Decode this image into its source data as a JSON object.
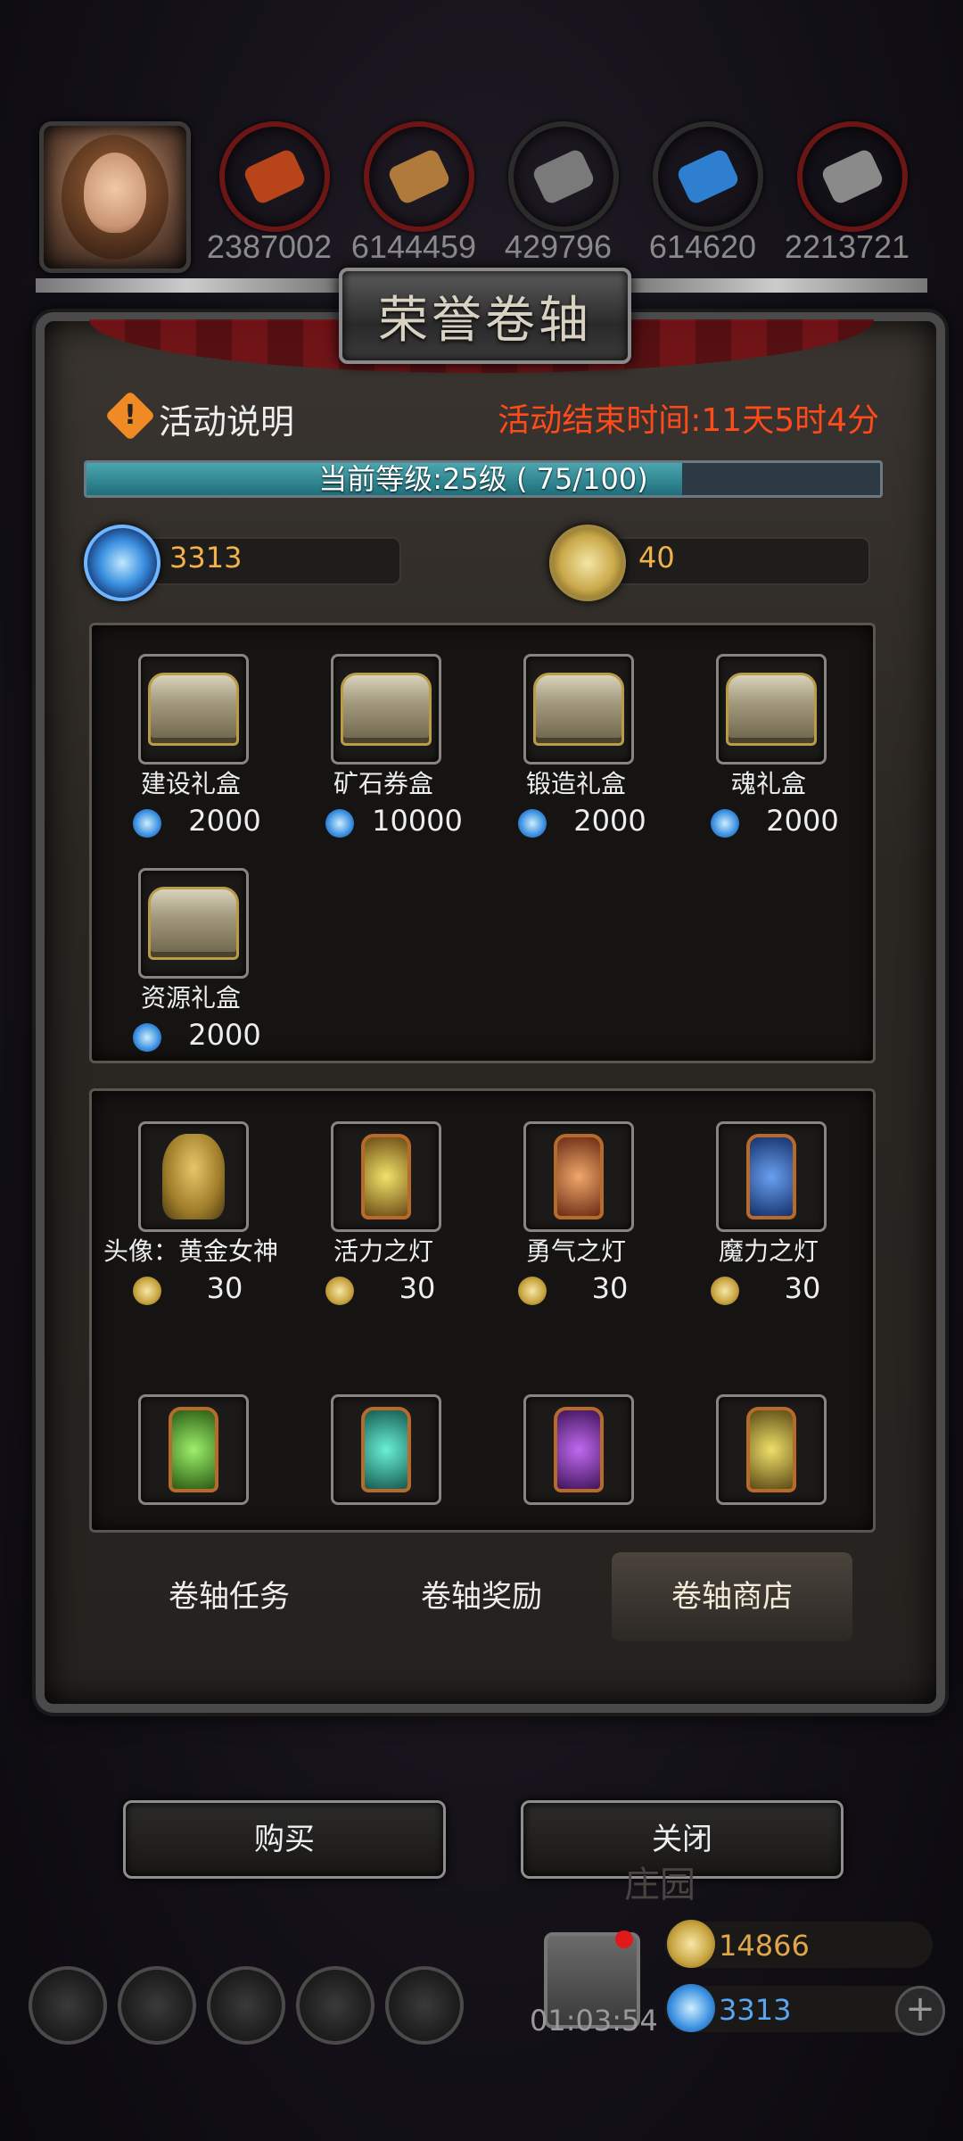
{
  "top_bar": {
    "resources": [
      {
        "icon": "meat-icon",
        "value": "2387002",
        "color": "#b8451a"
      },
      {
        "icon": "wood-icon",
        "value": "6144459",
        "color": "#b07a3a"
      },
      {
        "icon": "iron-icon",
        "value": "429796",
        "color": "#7a7a7a"
      },
      {
        "icon": "crystal-icon",
        "value": "614620",
        "color": "#2f7fd0"
      },
      {
        "icon": "steel-icon",
        "value": "2213721",
        "color": "#8a8a8a"
      }
    ]
  },
  "panel": {
    "title": "荣誉卷轴",
    "info_label": "活动说明",
    "end_time": "活动结束时间:11天5时4分",
    "level": {
      "text": "当前等级:25级 ( 75/100)",
      "current": 75,
      "max": 100
    },
    "diamonds": "3313",
    "coins": "40"
  },
  "shop1": [
    {
      "name": "建设礼盒",
      "cost": "2000",
      "currency": "diamond"
    },
    {
      "name": "矿石券盒",
      "cost": "10000",
      "currency": "diamond"
    },
    {
      "name": "锻造礼盒",
      "cost": "2000",
      "currency": "diamond"
    },
    {
      "name": "魂礼盒",
      "cost": "2000",
      "currency": "diamond"
    },
    {
      "name": "资源礼盒",
      "cost": "2000",
      "currency": "diamond"
    }
  ],
  "shop2": [
    {
      "name": "头像：黄金女神",
      "cost": "30",
      "currency": "coin",
      "icon": "angel-icon"
    },
    {
      "name": "活力之灯",
      "cost": "30",
      "currency": "coin",
      "icon": "lantern-icon",
      "glow": "#f2e36a"
    },
    {
      "name": "勇气之灯",
      "cost": "30",
      "currency": "coin",
      "icon": "lantern-icon",
      "glow": "#f0a86a"
    },
    {
      "name": "魔力之灯",
      "cost": "30",
      "currency": "coin",
      "icon": "lantern-icon",
      "glow": "#6aa0f0"
    },
    {
      "name": "",
      "cost": "",
      "currency": "coin",
      "icon": "lantern-icon",
      "glow": "#9ef06a"
    },
    {
      "name": "",
      "cost": "",
      "currency": "coin",
      "icon": "lantern-icon",
      "glow": "#6af0d8"
    },
    {
      "name": "",
      "cost": "",
      "currency": "coin",
      "icon": "lantern-icon",
      "glow": "#c06af0"
    },
    {
      "name": "",
      "cost": "",
      "currency": "coin",
      "icon": "lantern-icon",
      "glow": "#f0e06a"
    }
  ],
  "tabs": [
    {
      "label": "卷轴任务",
      "active": false
    },
    {
      "label": "卷轴奖励",
      "active": false
    },
    {
      "label": "卷轴商店",
      "active": true
    }
  ],
  "buttons": {
    "buy": "购买",
    "close": "关闭"
  },
  "bottom_bar": {
    "timer": "01:03:54",
    "gold": "14866",
    "diamonds": "3313",
    "faint_label": "庄园"
  }
}
